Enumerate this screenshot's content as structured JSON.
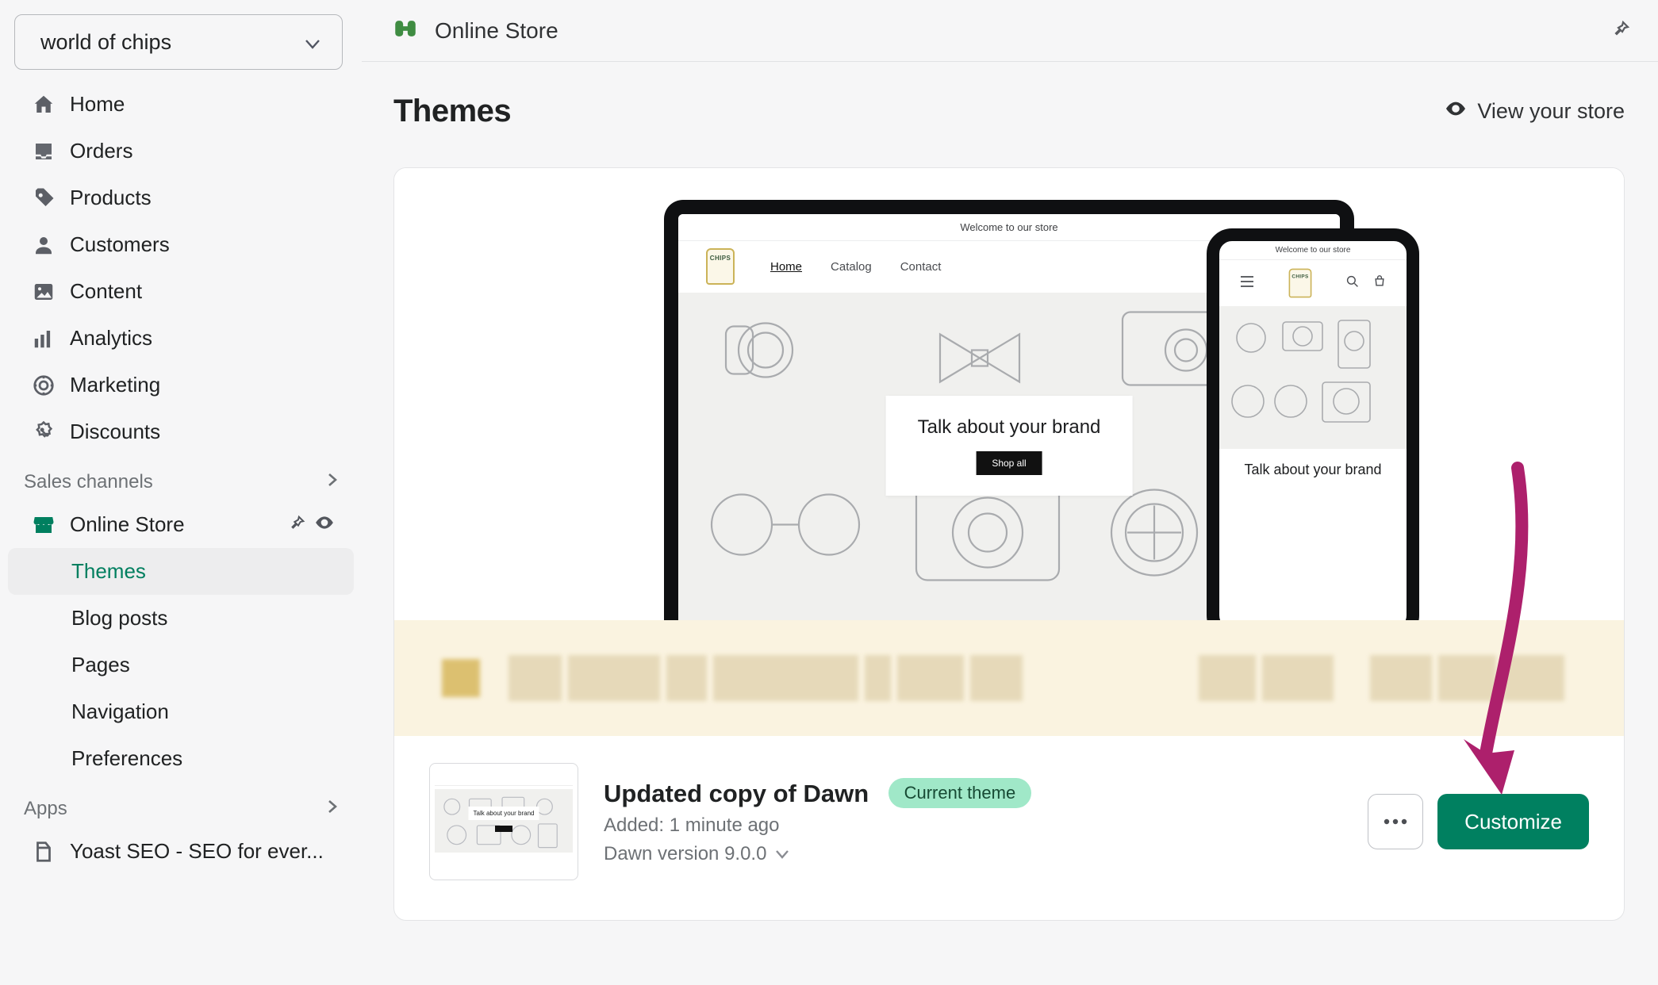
{
  "store_name": "world of chips",
  "sidebar": {
    "items": [
      {
        "icon": "home",
        "label": "Home"
      },
      {
        "icon": "orders",
        "label": "Orders"
      },
      {
        "icon": "products",
        "label": "Products"
      },
      {
        "icon": "customers",
        "label": "Customers"
      },
      {
        "icon": "content",
        "label": "Content"
      },
      {
        "icon": "analytics",
        "label": "Analytics"
      },
      {
        "icon": "marketing",
        "label": "Marketing"
      },
      {
        "icon": "discounts",
        "label": "Discounts"
      }
    ],
    "sales_channels_label": "Sales channels",
    "online_store": {
      "label": "Online Store",
      "sub": [
        "Themes",
        "Blog posts",
        "Pages",
        "Navigation",
        "Preferences"
      ],
      "active": "Themes"
    },
    "apps_label": "Apps",
    "app_item": "Yoast SEO - SEO for ever..."
  },
  "topbar": {
    "breadcrumb": "Online Store"
  },
  "page": {
    "title": "Themes",
    "view_store": "View your store"
  },
  "preview": {
    "announce": "Welcome to our store",
    "logo_text": "CHIPS",
    "nav": [
      "Home",
      "Catalog",
      "Contact"
    ],
    "hero_text": "Talk about your brand",
    "hero_cta": "Shop all",
    "mobile_hero_text": "Talk about your brand"
  },
  "theme": {
    "name": "Updated copy of Dawn",
    "badge": "Current theme",
    "added": "Added: 1 minute ago",
    "version": "Dawn version 9.0.0",
    "thumb_text": "Talk about your brand"
  },
  "actions": {
    "customize": "Customize"
  }
}
